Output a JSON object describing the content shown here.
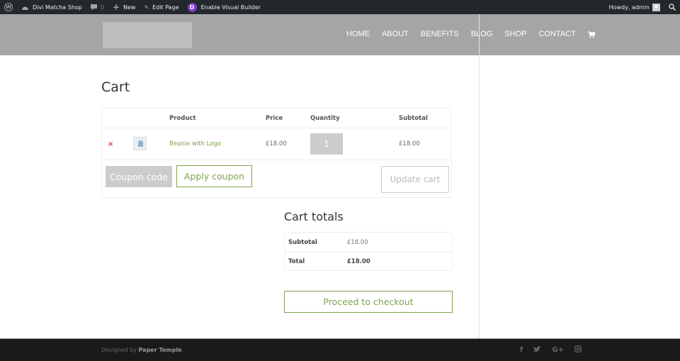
{
  "admin_bar": {
    "site_name": "Divi Matcha Shop",
    "comments_count": "0",
    "new_label": "New",
    "edit_label": "Edit Page",
    "divi_badge": "D",
    "visual_builder_label": "Enable Visual Builder",
    "greeting": "Howdy, admin",
    "icons": [
      "wordpress-logo-icon",
      "dashboard-icon",
      "comment-icon",
      "plus-icon",
      "pencil-icon",
      "divi-icon",
      "avatar-icon",
      "search-icon"
    ]
  },
  "header": {
    "nav": [
      "HOME",
      "ABOUT",
      "BENEFITS",
      "BLOG",
      "SHOP",
      "CONTACT"
    ],
    "cart_icon": "cart-icon"
  },
  "cart": {
    "title": "Cart",
    "columns": [
      "Product",
      "Price",
      "Quantity",
      "Subtotal"
    ],
    "items": [
      {
        "remove": "×",
        "name": "Beanie with Logo",
        "price": "£18.00",
        "quantity": "1",
        "subtotal": "£18.00"
      }
    ],
    "coupon_placeholder": "Coupon code",
    "apply_coupon": "Apply coupon",
    "update_cart": "Update cart"
  },
  "totals": {
    "title": "Cart totals",
    "subtotal_label": "Subtotal",
    "subtotal_value": "£18.00",
    "total_label": "Total",
    "total_value": "£18.00",
    "checkout": "Proceed to checkout"
  },
  "footer": {
    "credit_prefix": "Designed by ",
    "credit_name": "Paper Temple",
    "credit_suffix": ".",
    "social": [
      "f",
      "t",
      "G+",
      "ig"
    ]
  },
  "colors": {
    "accent": "#7ea34f",
    "remove": "#e2401c",
    "header_bg": "#a5a5a5",
    "adminbar_bg": "#23282d",
    "footer_bg": "#1a1a1a"
  }
}
